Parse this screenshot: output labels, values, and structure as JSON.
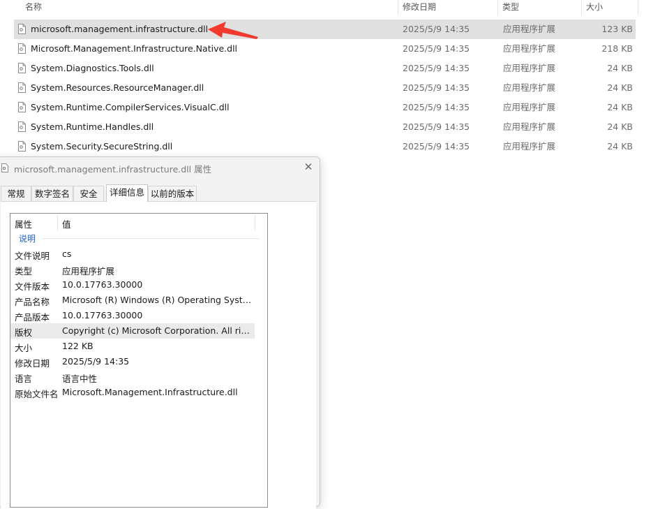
{
  "columns": {
    "name": "名称",
    "date": "修改日期",
    "type": "类型",
    "size": "大小"
  },
  "files": [
    {
      "name": "microsoft.management.infrastructure.dll",
      "date": "2025/5/9 14:35",
      "type": "应用程序扩展",
      "size": "123 KB",
      "selected": true
    },
    {
      "name": "Microsoft.Management.Infrastructure.Native.dll",
      "date": "2025/5/9 14:35",
      "type": "应用程序扩展",
      "size": "218 KB"
    },
    {
      "name": "System.Diagnostics.Tools.dll",
      "date": "2025/5/9 14:35",
      "type": "应用程序扩展",
      "size": "24 KB"
    },
    {
      "name": "System.Resources.ResourceManager.dll",
      "date": "2025/5/9 14:35",
      "type": "应用程序扩展",
      "size": "24 KB"
    },
    {
      "name": "System.Runtime.CompilerServices.VisualC.dll",
      "date": "2025/5/9 14:35",
      "type": "应用程序扩展",
      "size": "24 KB"
    },
    {
      "name": "System.Runtime.Handles.dll",
      "date": "2025/5/9 14:35",
      "type": "应用程序扩展",
      "size": "24 KB"
    },
    {
      "name": "System.Security.SecureString.dll",
      "date": "2025/5/9 14:35",
      "type": "应用程序扩展",
      "size": "24 KB"
    }
  ],
  "dialog": {
    "title": "microsoft.management.infrastructure.dll 属性",
    "close_glyph": "✕",
    "tabs": [
      "常规",
      "数字签名",
      "安全",
      "详细信息",
      "以前的版本"
    ],
    "active_tab": "详细信息",
    "list_header": {
      "property": "属性",
      "value": "值"
    },
    "group": "说明",
    "properties": [
      {
        "key": "文件说明",
        "value": "cs"
      },
      {
        "key": "类型",
        "value": "应用程序扩展"
      },
      {
        "key": "文件版本",
        "value": "10.0.17763.30000"
      },
      {
        "key": "产品名称",
        "value": "Microsoft (R) Windows (R) Operating System"
      },
      {
        "key": "产品版本",
        "value": "10.0.17763.30000"
      },
      {
        "key": "版权",
        "value": "Copyright (c) Microsoft Corporation. All righ...",
        "highlight": true
      },
      {
        "key": "大小",
        "value": "122 KB"
      },
      {
        "key": "修改日期",
        "value": "2025/5/9 14:35"
      },
      {
        "key": "语言",
        "value": "语言中性"
      },
      {
        "key": "原始文件名",
        "value": "Microsoft.Management.Infrastructure.dll"
      }
    ]
  },
  "colors": {
    "annotation_arrow": "#f23a2e",
    "selection": "#e0e0e0",
    "group_label": "#1f5fbf"
  },
  "icons": {
    "file": "dll-file-icon",
    "close": "close-icon",
    "annotation": "red-arrow-annotation"
  }
}
